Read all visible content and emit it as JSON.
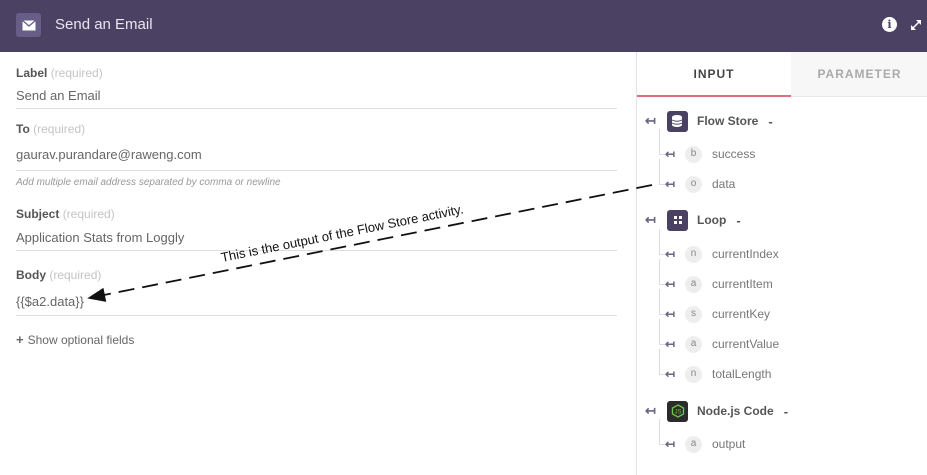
{
  "header": {
    "title": "Send an Email",
    "app_icon": "envelope-icon",
    "info_icon": "info-icon",
    "expand_icon": "expand-icon"
  },
  "form": {
    "fields": [
      {
        "label": "Label",
        "required": "(required)",
        "value": "Send an Email"
      },
      {
        "label": "To",
        "required": "(required)",
        "value": "gaurav.purandare@raweng.com",
        "hint": "Add multiple email address separated by comma or newline"
      },
      {
        "label": "Subject",
        "required": "(required)",
        "value": "Application Stats from Loggly"
      },
      {
        "label": "Body",
        "required": "(required)",
        "value": "{{$a2.data}}"
      }
    ],
    "optional_label": "Show optional fields"
  },
  "panel": {
    "tabs": [
      "INPUT",
      "PARAMETER"
    ],
    "active_tab": "INPUT",
    "nodes": [
      {
        "name": "Flow Store",
        "collapse": "-",
        "icon": "database-icon",
        "items": [
          {
            "type": "b",
            "name": "success"
          },
          {
            "type": "o",
            "name": "data"
          }
        ]
      },
      {
        "name": "Loop",
        "collapse": "-",
        "icon": "loop-grid-icon",
        "items": [
          {
            "type": "n",
            "name": "currentIndex"
          },
          {
            "type": "a",
            "name": "currentItem"
          },
          {
            "type": "s",
            "name": "currentKey"
          },
          {
            "type": "a",
            "name": "currentValue"
          },
          {
            "type": "n",
            "name": "totalLength"
          }
        ]
      },
      {
        "name": "Node.js Code",
        "collapse": "-",
        "icon": "nodejs-icon",
        "items": [
          {
            "type": "a",
            "name": "output"
          }
        ]
      }
    ]
  },
  "annotation": {
    "text": "This is the output of the Flow Store activity."
  },
  "colors": {
    "header_bg": "#4a4163",
    "accent": "#e06c80"
  }
}
